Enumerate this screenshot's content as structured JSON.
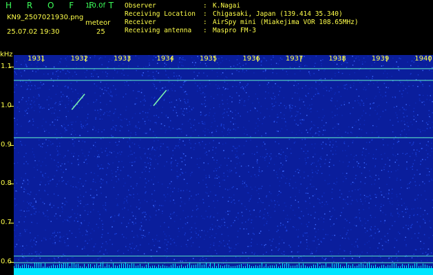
{
  "header": {
    "app_title": "H R O F F T",
    "version": "1.0.0f",
    "filename": "KN9_2507021930.png",
    "mode": "meteor",
    "datetime": "25.07.02 19:30",
    "count": "25"
  },
  "info": [
    {
      "label": "Observer",
      "value": "K.Nagai"
    },
    {
      "label": "Receiving Location",
      "value": "Chigasaki, Japan (139.414 35.340)"
    },
    {
      "label": "Receiver",
      "value": "AirSpy mini (Miakejima VOR 108.65MHz)"
    },
    {
      "label": "Receiving antenna",
      "value": "Maspro FM-3"
    }
  ],
  "spectrogram": {
    "y_unit": "kHz",
    "y_labels": [
      "1.1",
      "1.0",
      "0.9",
      "0.8",
      "0.7",
      "0.6"
    ],
    "y_values": [
      1.1,
      1.0,
      0.9,
      0.8,
      0.7,
      0.6
    ],
    "y_range": [
      0.57,
      1.13
    ],
    "time_labels": [
      "1931",
      "1932",
      "1933",
      "1934",
      "1935",
      "1936",
      "1937",
      "1938",
      "1939",
      "1940"
    ],
    "colors": {
      "background": "#0a1e9c",
      "noise": "#1a40d8",
      "line": "#5ee8c8",
      "axis": "#ffff4a",
      "header_green": "#3cff5a"
    },
    "carrier_lines_khz": [
      1.095,
      1.065,
      0.918,
      0.615,
      0.598
    ],
    "meteors": [
      {
        "t_start": 1931.9,
        "t_end": 1932.2,
        "f_start": 0.99,
        "f_end": 1.03
      },
      {
        "t_start": 1933.8,
        "t_end": 1934.1,
        "f_start": 1.0,
        "f_end": 1.04
      }
    ]
  }
}
